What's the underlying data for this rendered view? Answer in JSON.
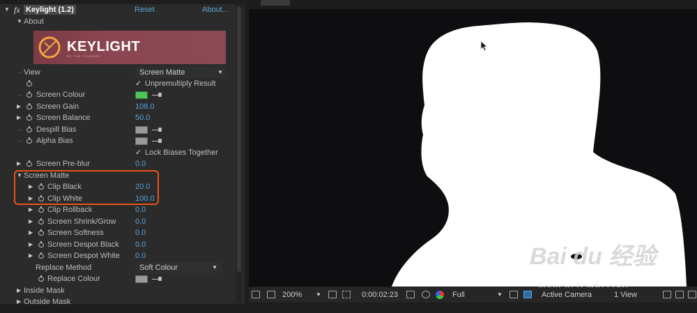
{
  "effect": {
    "name": "Keylight (1.2)",
    "reset_label": "Reset",
    "about_label": "About...",
    "about_group": "About",
    "logo_text": "KEYLIGHT",
    "logo_sub": "BY THE FOUNDRY"
  },
  "view": {
    "label": "View",
    "value": "Screen Matte"
  },
  "unpremultiply": {
    "label": "Unpremultiply Result",
    "checked": true
  },
  "screen_colour": {
    "label": "Screen Colour",
    "color": "#4ec45a"
  },
  "screen_gain": {
    "label": "Screen Gain",
    "value": "108.0"
  },
  "screen_balance": {
    "label": "Screen Balance",
    "value": "50.0"
  },
  "despill_bias": {
    "label": "Despill Bias"
  },
  "alpha_bias": {
    "label": "Alpha Bias"
  },
  "lock_biases": {
    "label": "Lock Biases Together",
    "checked": true
  },
  "screen_preblur": {
    "label": "Screen Pre-blur",
    "value": "0.0"
  },
  "screen_matte": {
    "label": "Screen Matte",
    "clip_black": {
      "label": "Clip Black",
      "value": "20.0"
    },
    "clip_white": {
      "label": "Clip White",
      "value": "100.0"
    },
    "clip_rollback": {
      "label": "Clip Rollback",
      "value": "0.0"
    },
    "shrink_grow": {
      "label": "Screen Shrink/Grow",
      "value": "0.0"
    },
    "softness": {
      "label": "Screen Softness",
      "value": "0.0"
    },
    "despot_black": {
      "label": "Screen Despot Black",
      "value": "0.0"
    },
    "despot_white": {
      "label": "Screen Despot White",
      "value": "0.0"
    },
    "replace_method": {
      "label": "Replace Method",
      "value": "Soft Colour"
    },
    "replace_colour": {
      "label": "Replace Colour"
    }
  },
  "inside_mask": {
    "label": "Inside Mask"
  },
  "outside_mask": {
    "label": "Outside Mask"
  },
  "viewer": {
    "zoom": "200%",
    "timecode": "0:00:02:23",
    "resolution": "Full",
    "camera": "Active Camera",
    "views": "1 View"
  },
  "watermark": {
    "brand": "Bai du 经验",
    "url": "jingyan.baidu.com"
  },
  "colors": {
    "accent_value": "#5ba3d8",
    "highlight": "#e8541a",
    "matte_white": "#ffffff"
  }
}
